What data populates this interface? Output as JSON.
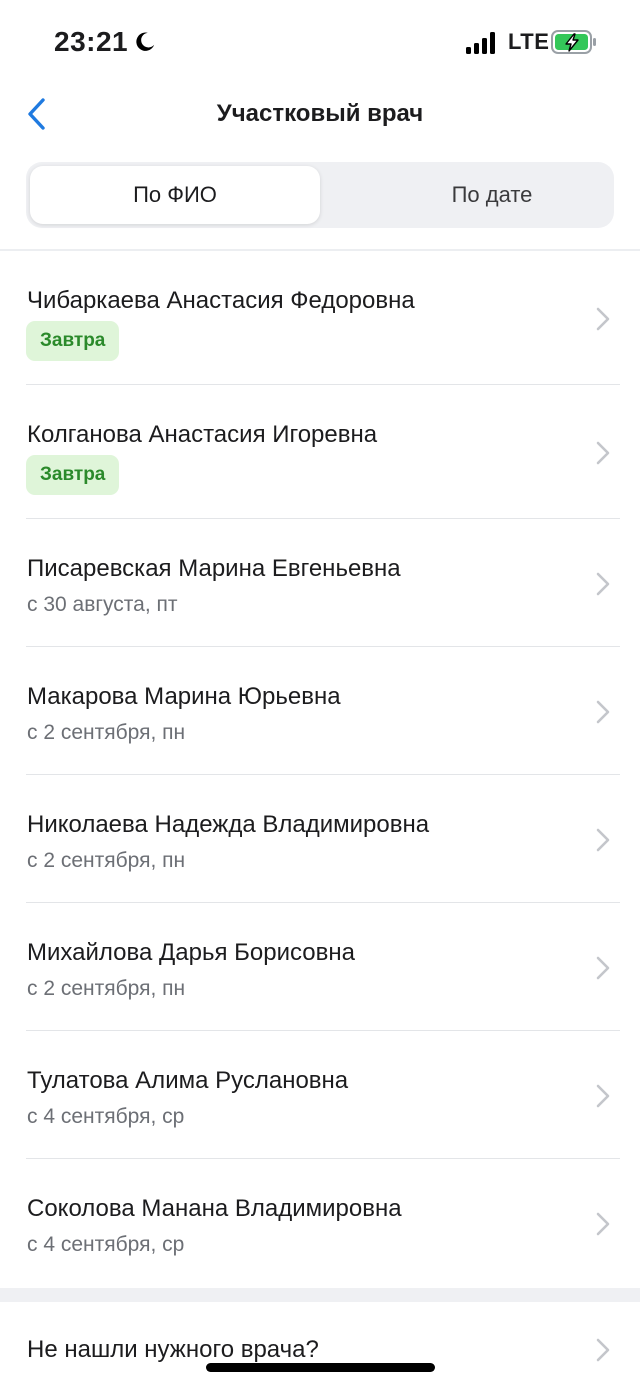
{
  "status_bar": {
    "time": "23:21",
    "network": "LTE",
    "icons": [
      "moon-icon",
      "signal-icon",
      "battery-charging-icon"
    ]
  },
  "nav": {
    "title": "Участковый врач",
    "back_icon": "chevron-left-icon"
  },
  "tabs": [
    {
      "label": "По ФИО",
      "active": true
    },
    {
      "label": "По дате",
      "active": false
    }
  ],
  "colors": {
    "accent": "#1f7ae0",
    "badge_bg": "#dff5d9",
    "badge_text": "#2b8a2b",
    "secondary_text": "#6c6f75"
  },
  "doctors": [
    {
      "name": "Чибаркаева Анастасия Федоровна",
      "badge": "Завтра",
      "date": null
    },
    {
      "name": "Колганова Анастасия Игоревна",
      "badge": "Завтра",
      "date": null
    },
    {
      "name": "Писаревская Марина Евгеньевна",
      "badge": null,
      "date": "с 30 августа, пт"
    },
    {
      "name": "Макарова Марина Юрьевна",
      "badge": null,
      "date": "с 2 сентября, пн"
    },
    {
      "name": "Николаева Надежда Владимировна",
      "badge": null,
      "date": "с 2 сентября, пн"
    },
    {
      "name": "Михайлова Дарья Борисовна",
      "badge": null,
      "date": "с 2 сентября, пн"
    },
    {
      "name": "Тулатова Алима Руслановна",
      "badge": null,
      "date": "с 4 сентября, ср"
    },
    {
      "name": "Соколова Манана Владимировна",
      "badge": null,
      "date": "с 4 сентября, ср"
    }
  ],
  "not_found": {
    "label": "Не нашли нужного врача?"
  }
}
